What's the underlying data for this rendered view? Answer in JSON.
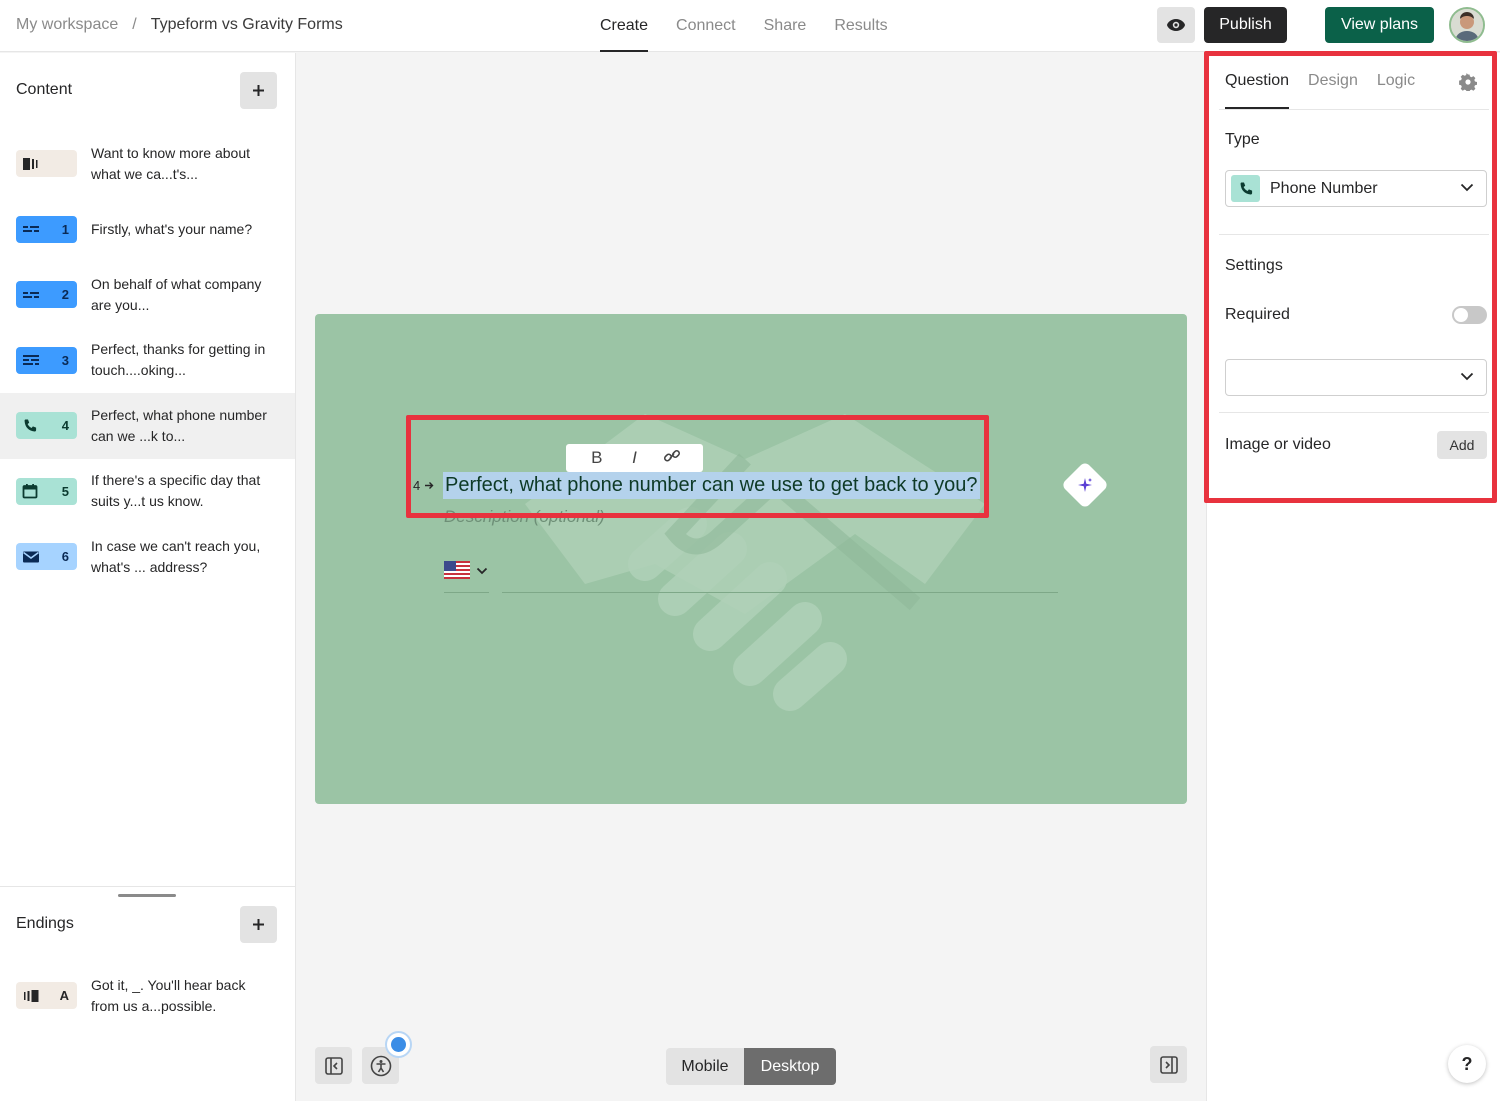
{
  "topbar": {
    "workspace": "My workspace",
    "separator": "/",
    "form_title": "Typeform vs Gravity Forms",
    "tabs": [
      {
        "label": "Create",
        "active": true
      },
      {
        "label": "Connect",
        "active": false
      },
      {
        "label": "Share",
        "active": false
      },
      {
        "label": "Results",
        "active": false
      }
    ],
    "preview_icon": "eye-icon",
    "publish_label": "Publish",
    "view_plans_label": "View plans"
  },
  "sidebar": {
    "content_heading": "Content",
    "questions": [
      {
        "type_icon": "welcome-screen-icon",
        "number": "",
        "text": "Want to know more about what we ca...t's...",
        "color": "#f2ebe4",
        "active": false
      },
      {
        "type_icon": "short-text-icon",
        "number": "1",
        "text": "Firstly, what's your name?",
        "color": "#3d9bff",
        "active": false
      },
      {
        "type_icon": "short-text-icon",
        "number": "2",
        "text": "On behalf of what company are you...",
        "color": "#3d9bff",
        "active": false
      },
      {
        "type_icon": "long-text-icon",
        "number": "3",
        "text": "Perfect, thanks for getting in touch....oking...",
        "color": "#3d9bff",
        "active": false
      },
      {
        "type_icon": "phone-icon",
        "number": "4",
        "text": "Perfect, what phone number can we ...k to...",
        "color": "#a9e2d5",
        "active": true
      },
      {
        "type_icon": "calendar-icon",
        "number": "5",
        "text": "If there's a specific day that suits y...t us know.",
        "color": "#a9e2d5",
        "active": false
      },
      {
        "type_icon": "email-icon",
        "number": "6",
        "text": "In case we can't reach you, what's ... address?",
        "color": "#a6d3ff",
        "active": false
      }
    ],
    "endings_heading": "Endings",
    "ending": {
      "type_icon": "ending-screen-icon",
      "letter": "A",
      "text": "Got it, _. You'll hear back from us a...possible.",
      "color": "#f2ebe4"
    }
  },
  "canvas": {
    "question_number": "4",
    "question_title": "Perfect, what phone number can we use to get back to you?",
    "description_placeholder": "Description (optional)",
    "format_bold": "B",
    "format_italic": "I",
    "country_flag": "us-flag-icon",
    "card_color": "#9bc4a5",
    "device_mobile": "Mobile",
    "device_desktop": "Desktop",
    "active_device": "Desktop"
  },
  "rpanel": {
    "tabs": [
      {
        "label": "Question",
        "active": true
      },
      {
        "label": "Design",
        "active": false
      },
      {
        "label": "Logic",
        "active": false
      }
    ],
    "type_label": "Type",
    "type_value": "Phone Number",
    "settings_label": "Settings",
    "required_label": "Required",
    "required_on": false,
    "media_label": "Image or video",
    "media_add": "Add"
  },
  "help_label": "?",
  "colors": {
    "accent_red": "#e8323e",
    "publish": "#262627",
    "plans": "#0b6149"
  }
}
